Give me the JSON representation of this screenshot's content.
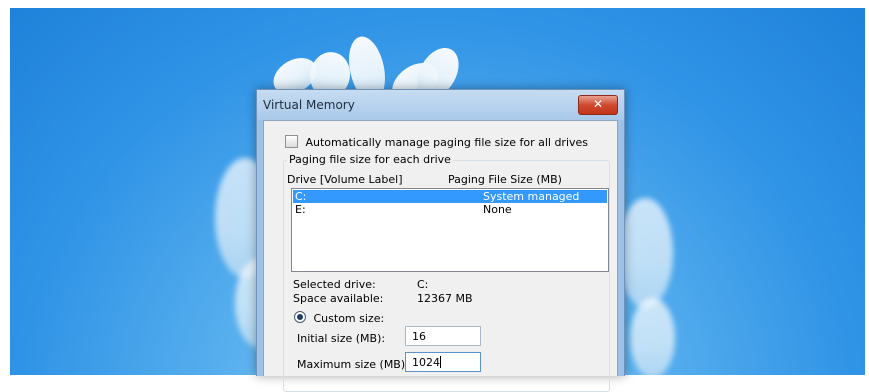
{
  "window": {
    "title": "Virtual Memory",
    "close_label": "✕"
  },
  "auto_manage": {
    "label": "Automatically manage paging file size for all drives",
    "checked": false
  },
  "group": {
    "title": "Paging file size for each drive",
    "columns": [
      "Drive  [Volume Label]",
      "Paging File Size (MB)"
    ],
    "rows": [
      {
        "drive": "C:",
        "size": "System managed",
        "selected": true
      },
      {
        "drive": "E:",
        "size": "None",
        "selected": false
      }
    ]
  },
  "selected_drive": {
    "label": "Selected drive:",
    "value": "C:"
  },
  "space_available": {
    "label": "Space available:",
    "value": "12367 MB"
  },
  "custom_size": {
    "label": "Custom size:",
    "selected": true
  },
  "initial_size": {
    "label": "Initial size (MB):",
    "value": "16"
  },
  "maximum_size": {
    "label": "Maximum size (MB):",
    "value": "1024"
  },
  "colors": {
    "desktop": "#2f93e6",
    "titlebar": "#a9c9ea",
    "selection": "#3399ff",
    "close": "#c2361c"
  }
}
